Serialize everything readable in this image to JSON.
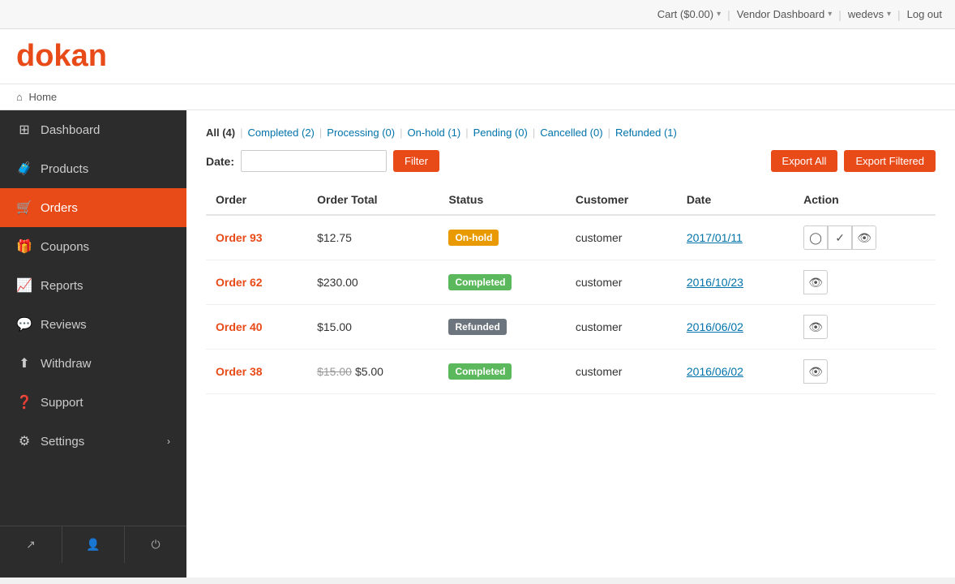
{
  "topbar": {
    "cart_label": "Cart ($0.00)",
    "cart_arrow": "▾",
    "vendor_label": "Vendor Dashboard",
    "vendor_arrow": "▾",
    "user_label": "wedevs",
    "user_arrow": "▾",
    "logout_label": "Log out"
  },
  "logo": {
    "letter": "d",
    "rest": "okan"
  },
  "breadcrumb": {
    "home_label": "Home"
  },
  "sidebar": {
    "items": [
      {
        "id": "dashboard",
        "label": "Dashboard",
        "icon": "⊞"
      },
      {
        "id": "products",
        "label": "Products",
        "icon": "🧳"
      },
      {
        "id": "orders",
        "label": "Orders",
        "icon": "🛒"
      },
      {
        "id": "coupons",
        "label": "Coupons",
        "icon": "🎁"
      },
      {
        "id": "reports",
        "label": "Reports",
        "icon": "📈"
      },
      {
        "id": "reviews",
        "label": "Reviews",
        "icon": "💬"
      },
      {
        "id": "withdraw",
        "label": "Withdraw",
        "icon": "⬆"
      },
      {
        "id": "support",
        "label": "Support",
        "icon": "❓"
      },
      {
        "id": "settings",
        "label": "Settings",
        "icon": "⚙",
        "arrow": "›"
      }
    ],
    "bottom": [
      {
        "id": "external",
        "icon": "↗"
      },
      {
        "id": "user",
        "icon": "👤"
      },
      {
        "id": "power",
        "icon": "⏻"
      }
    ]
  },
  "filters": {
    "tabs": [
      {
        "id": "all",
        "label": "All",
        "count": 4,
        "display": "All (4)"
      },
      {
        "id": "completed",
        "label": "Completed",
        "count": 2,
        "display": "Completed (2)"
      },
      {
        "id": "processing",
        "label": "Processing",
        "count": 0,
        "display": "Processing (0)"
      },
      {
        "id": "on-hold",
        "label": "On-hold",
        "count": 1,
        "display": "On-hold (1)"
      },
      {
        "id": "pending",
        "label": "Pending",
        "count": 0,
        "display": "Pending (0)"
      },
      {
        "id": "cancelled",
        "label": "Cancelled",
        "count": 0,
        "display": "Cancelled (0)"
      },
      {
        "id": "refunded",
        "label": "Refunded",
        "count": 1,
        "display": "Refunded (1)"
      }
    ]
  },
  "date_filter": {
    "label": "Date:",
    "placeholder": "",
    "filter_btn": "Filter"
  },
  "export": {
    "export_all_label": "Export All",
    "export_filtered_label": "Export Filtered"
  },
  "table": {
    "headers": [
      "Order",
      "Order Total",
      "Status",
      "Customer",
      "Date",
      "Action"
    ],
    "rows": [
      {
        "order": "Order 93",
        "total": "$12.75",
        "total_original": null,
        "status": "On-hold",
        "status_type": "onhold",
        "customer": "customer",
        "date": "2017/01/11",
        "actions": [
          "process",
          "complete",
          "view"
        ]
      },
      {
        "order": "Order 62",
        "total": "$230.00",
        "total_original": null,
        "status": "Completed",
        "status_type": "completed",
        "customer": "customer",
        "date": "2016/10/23",
        "actions": [
          "view"
        ]
      },
      {
        "order": "Order 40",
        "total": "$15.00",
        "total_original": null,
        "status": "Refunded",
        "status_type": "refunded",
        "customer": "customer",
        "date": "2016/06/02",
        "actions": [
          "view"
        ]
      },
      {
        "order": "Order 38",
        "total": "$5.00",
        "total_original": "$15.00",
        "status": "Completed",
        "status_type": "completed",
        "customer": "customer",
        "date": "2016/06/02",
        "actions": [
          "view"
        ]
      }
    ]
  }
}
